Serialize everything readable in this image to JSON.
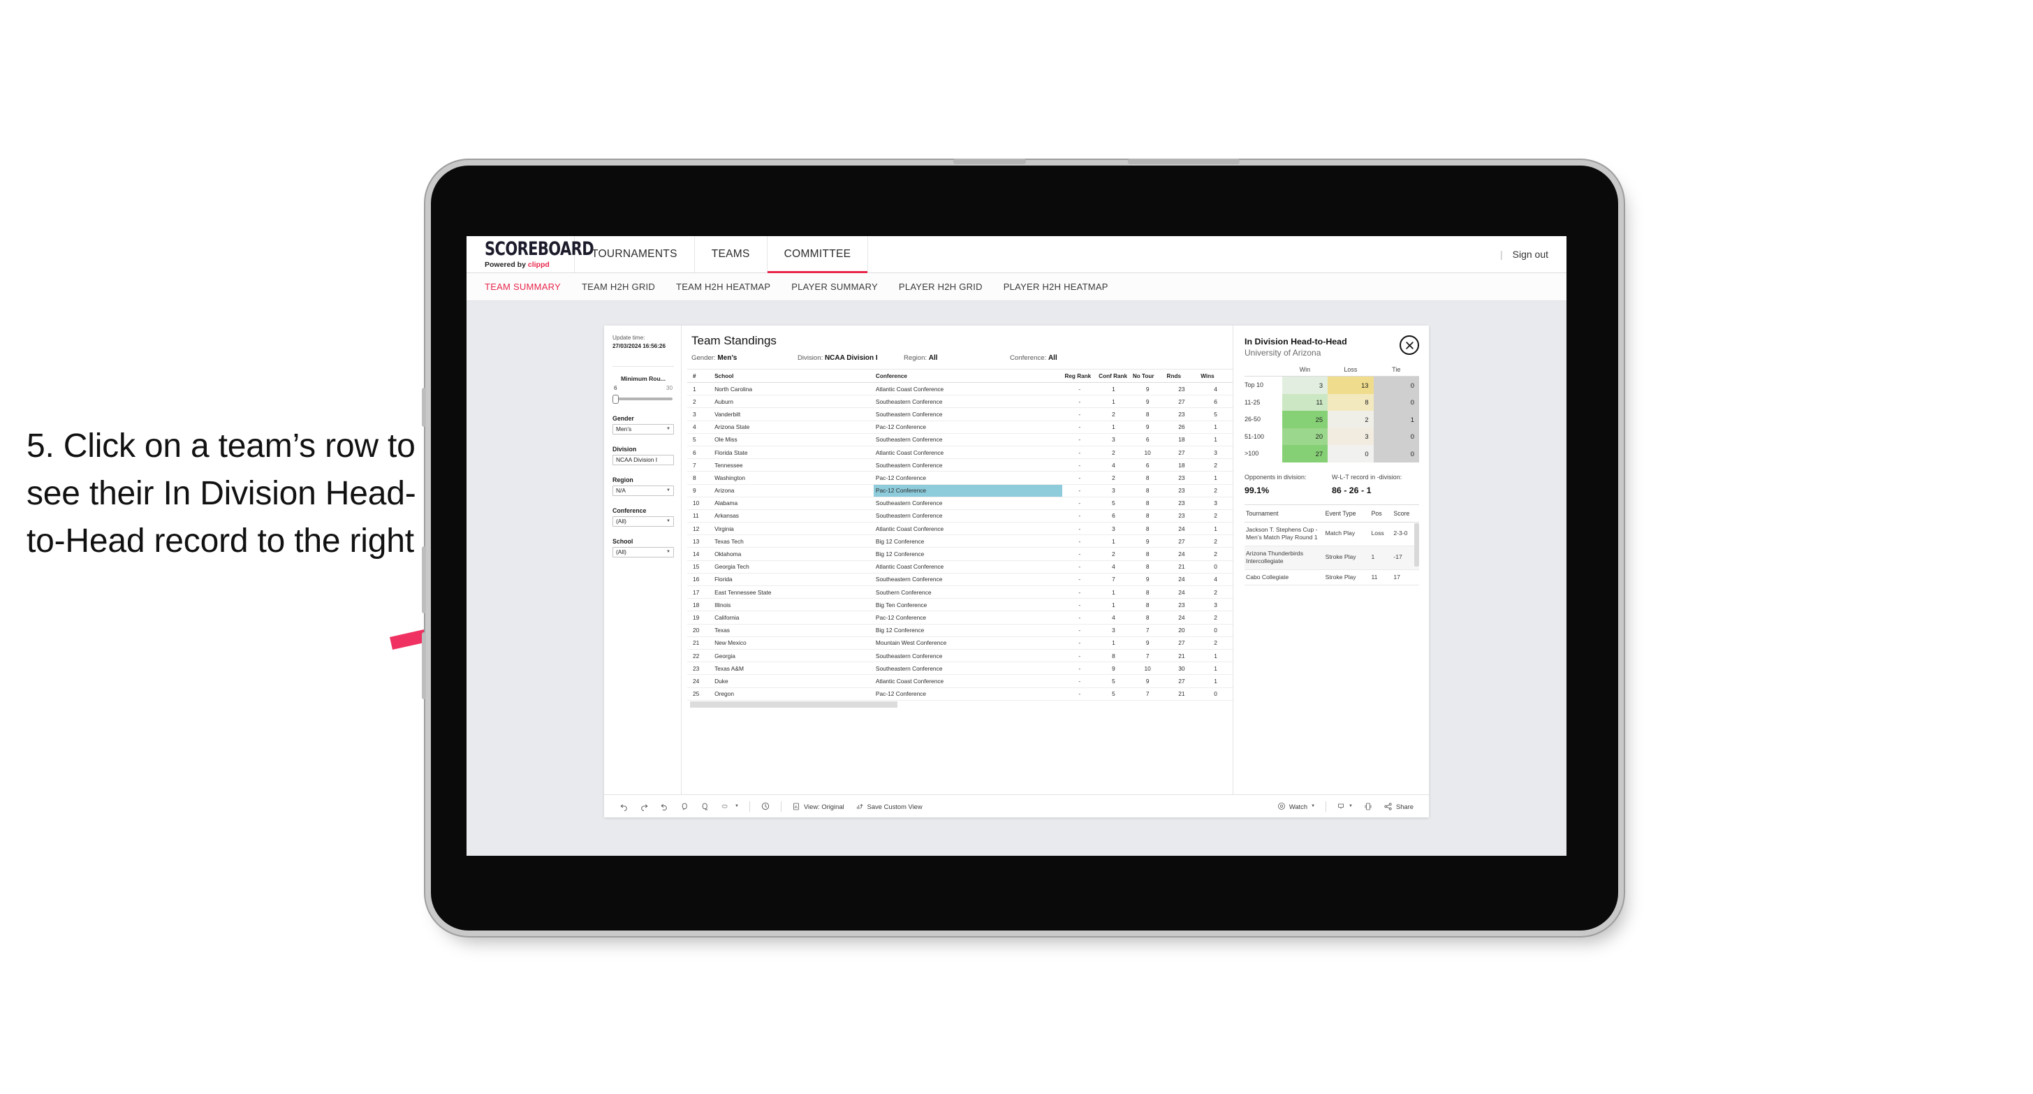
{
  "annotation": {
    "text": "5. Click on a team’s row to see their In Division Head-to-Head record to the right",
    "accent_color": "#e8274b"
  },
  "topnav": {
    "logo_main": "SCOREBOARD",
    "logo_powered": "Powered by",
    "logo_brand": "clippd",
    "items": [
      {
        "label": "TOURNAMENTS",
        "active": false
      },
      {
        "label": "TEAMS",
        "active": false
      },
      {
        "label": "COMMITTEE",
        "active": true
      }
    ],
    "separator": "|",
    "signout": "Sign out"
  },
  "subnav": {
    "items": [
      {
        "label": "TEAM SUMMARY",
        "active": true
      },
      {
        "label": "TEAM H2H GRID",
        "active": false
      },
      {
        "label": "TEAM H2H HEATMAP",
        "active": false
      },
      {
        "label": "PLAYER SUMMARY",
        "active": false
      },
      {
        "label": "PLAYER H2H GRID",
        "active": false
      },
      {
        "label": "PLAYER H2H HEATMAP",
        "active": false
      }
    ]
  },
  "filters": {
    "update_label": "Update time:",
    "update_time": "27/03/2024 16:56:26",
    "slider": {
      "title": "Minimum Rou...",
      "min": "6",
      "max": "30"
    },
    "groups": [
      {
        "label": "Gender",
        "value": "Men’s"
      },
      {
        "label": "Division",
        "value": "NCAA Division I"
      },
      {
        "label": "Region",
        "value": "N/A"
      },
      {
        "label": "Conference",
        "value": "(All)"
      },
      {
        "label": "School",
        "value": "(All)"
      }
    ]
  },
  "standings": {
    "title": "Team Standings",
    "meta": [
      {
        "key": "Gender:",
        "value": "Men’s"
      },
      {
        "key": "Division:",
        "value": "NCAA Division I"
      },
      {
        "key": "Region:",
        "value": "All"
      },
      {
        "key": "Conference:",
        "value": "All"
      }
    ],
    "columns": [
      "#",
      "School",
      "Conference",
      "Reg Rank",
      "Conf Rank",
      "No Tour",
      "Rnds",
      "Wins"
    ],
    "rows": [
      {
        "rank": "1",
        "school": "North Carolina",
        "conference": "Atlantic Coast Conference",
        "reg": "-",
        "conf": "1",
        "tour": "9",
        "rnds": "23",
        "wins": "4",
        "highlight": false
      },
      {
        "rank": "2",
        "school": "Auburn",
        "conference": "Southeastern Conference",
        "reg": "-",
        "conf": "1",
        "tour": "9",
        "rnds": "27",
        "wins": "6",
        "highlight": false
      },
      {
        "rank": "3",
        "school": "Vanderbilt",
        "conference": "Southeastern Conference",
        "reg": "-",
        "conf": "2",
        "tour": "8",
        "rnds": "23",
        "wins": "5",
        "highlight": false
      },
      {
        "rank": "4",
        "school": "Arizona State",
        "conference": "Pac-12 Conference",
        "reg": "-",
        "conf": "1",
        "tour": "9",
        "rnds": "26",
        "wins": "1",
        "highlight": false
      },
      {
        "rank": "5",
        "school": "Ole Miss",
        "conference": "Southeastern Conference",
        "reg": "-",
        "conf": "3",
        "tour": "6",
        "rnds": "18",
        "wins": "1",
        "highlight": false
      },
      {
        "rank": "6",
        "school": "Florida State",
        "conference": "Atlantic Coast Conference",
        "reg": "-",
        "conf": "2",
        "tour": "10",
        "rnds": "27",
        "wins": "3",
        "highlight": false
      },
      {
        "rank": "7",
        "school": "Tennessee",
        "conference": "Southeastern Conference",
        "reg": "-",
        "conf": "4",
        "tour": "6",
        "rnds": "18",
        "wins": "2",
        "highlight": false
      },
      {
        "rank": "8",
        "school": "Washington",
        "conference": "Pac-12 Conference",
        "reg": "-",
        "conf": "2",
        "tour": "8",
        "rnds": "23",
        "wins": "1",
        "highlight": false
      },
      {
        "rank": "9",
        "school": "Arizona",
        "conference": "Pac-12 Conference",
        "reg": "-",
        "conf": "3",
        "tour": "8",
        "rnds": "23",
        "wins": "2",
        "highlight": true
      },
      {
        "rank": "10",
        "school": "Alabama",
        "conference": "Southeastern Conference",
        "reg": "-",
        "conf": "5",
        "tour": "8",
        "rnds": "23",
        "wins": "3",
        "highlight": false
      },
      {
        "rank": "11",
        "school": "Arkansas",
        "conference": "Southeastern Conference",
        "reg": "-",
        "conf": "6",
        "tour": "8",
        "rnds": "23",
        "wins": "2",
        "highlight": false
      },
      {
        "rank": "12",
        "school": "Virginia",
        "conference": "Atlantic Coast Conference",
        "reg": "-",
        "conf": "3",
        "tour": "8",
        "rnds": "24",
        "wins": "1",
        "highlight": false
      },
      {
        "rank": "13",
        "school": "Texas Tech",
        "conference": "Big 12 Conference",
        "reg": "-",
        "conf": "1",
        "tour": "9",
        "rnds": "27",
        "wins": "2",
        "highlight": false
      },
      {
        "rank": "14",
        "school": "Oklahoma",
        "conference": "Big 12 Conference",
        "reg": "-",
        "conf": "2",
        "tour": "8",
        "rnds": "24",
        "wins": "2",
        "highlight": false
      },
      {
        "rank": "15",
        "school": "Georgia Tech",
        "conference": "Atlantic Coast Conference",
        "reg": "-",
        "conf": "4",
        "tour": "8",
        "rnds": "21",
        "wins": "0",
        "highlight": false
      },
      {
        "rank": "16",
        "school": "Florida",
        "conference": "Southeastern Conference",
        "reg": "-",
        "conf": "7",
        "tour": "9",
        "rnds": "24",
        "wins": "4",
        "highlight": false
      },
      {
        "rank": "17",
        "school": "East Tennessee State",
        "conference": "Southern Conference",
        "reg": "-",
        "conf": "1",
        "tour": "8",
        "rnds": "24",
        "wins": "2",
        "highlight": false
      },
      {
        "rank": "18",
        "school": "Illinois",
        "conference": "Big Ten Conference",
        "reg": "-",
        "conf": "1",
        "tour": "8",
        "rnds": "23",
        "wins": "3",
        "highlight": false
      },
      {
        "rank": "19",
        "school": "California",
        "conference": "Pac-12 Conference",
        "reg": "-",
        "conf": "4",
        "tour": "8",
        "rnds": "24",
        "wins": "2",
        "highlight": false
      },
      {
        "rank": "20",
        "school": "Texas",
        "conference": "Big 12 Conference",
        "reg": "-",
        "conf": "3",
        "tour": "7",
        "rnds": "20",
        "wins": "0",
        "highlight": false
      },
      {
        "rank": "21",
        "school": "New Mexico",
        "conference": "Mountain West Conference",
        "reg": "-",
        "conf": "1",
        "tour": "9",
        "rnds": "27",
        "wins": "2",
        "highlight": false
      },
      {
        "rank": "22",
        "school": "Georgia",
        "conference": "Southeastern Conference",
        "reg": "-",
        "conf": "8",
        "tour": "7",
        "rnds": "21",
        "wins": "1",
        "highlight": false
      },
      {
        "rank": "23",
        "school": "Texas A&M",
        "conference": "Southeastern Conference",
        "reg": "-",
        "conf": "9",
        "tour": "10",
        "rnds": "30",
        "wins": "1",
        "highlight": false
      },
      {
        "rank": "24",
        "school": "Duke",
        "conference": "Atlantic Coast Conference",
        "reg": "-",
        "conf": "5",
        "tour": "9",
        "rnds": "27",
        "wins": "1",
        "highlight": false
      },
      {
        "rank": "25",
        "school": "Oregon",
        "conference": "Pac-12 Conference",
        "reg": "-",
        "conf": "5",
        "tour": "7",
        "rnds": "21",
        "wins": "0",
        "highlight": false
      }
    ]
  },
  "h2h": {
    "title": "In Division Head-to-Head",
    "subtitle": "University of Arizona",
    "close_icon": "close-icon",
    "opponents_label": "Opponents in division:",
    "opponents_value": "99.1%",
    "record_label": "W-L-T record in -division:",
    "record_value": "86 - 26 - 1",
    "tournament_columns": [
      "Tournament",
      "Event Type",
      "Pos",
      "Score"
    ],
    "tournaments": [
      {
        "name": "Jackson T. Stephens Cup - Men’s Match Play Round 1",
        "type": "Match Play",
        "pos": "Loss",
        "score": "2-3-0"
      },
      {
        "name": "Arizona Thunderbirds Intercollegiate",
        "type": "Stroke Play",
        "pos": "1",
        "score": "-17"
      },
      {
        "name": "Cabo Collegiate",
        "type": "Stroke Play",
        "pos": "11",
        "score": "17"
      }
    ]
  },
  "chart_data": {
    "type": "heatmap",
    "title": "In Division Head-to-Head",
    "subtitle": "University of Arizona",
    "columns": [
      "Win",
      "Loss",
      "Tie"
    ],
    "categories": [
      "Top 10",
      "11-25",
      "26-50",
      "51-100",
      ">100"
    ],
    "series": [
      {
        "name": "Win",
        "values": [
          3,
          11,
          25,
          20,
          27
        ]
      },
      {
        "name": "Loss",
        "values": [
          13,
          8,
          2,
          3,
          0
        ]
      },
      {
        "name": "Tie",
        "values": [
          0,
          0,
          1,
          0,
          0
        ]
      }
    ],
    "cell_colors": {
      "win": [
        "#e2efe0",
        "#cce7c3",
        "#86d076",
        "#9bd78c",
        "#85cf75"
      ],
      "loss": [
        "#efdc8c",
        "#f3e9bf",
        "#f0efe7",
        "#f2ece0",
        "#f1f1ef"
      ],
      "tie": [
        "#cfcfcf",
        "#cfcfcf",
        "#cfcfcf",
        "#cfcfcf",
        "#cfcfcf"
      ]
    },
    "legend_position": "top",
    "grid": false
  },
  "toolbar": {
    "items": [
      {
        "name": "undo-icon",
        "label": ""
      },
      {
        "name": "redo-icon",
        "label": ""
      },
      {
        "name": "revert-icon",
        "label": ""
      },
      {
        "name": "refresh-icon",
        "label": ""
      },
      {
        "name": "pause-icon",
        "label": ""
      },
      {
        "name": "highlight-icon",
        "label": ""
      },
      {
        "name": "pause-auto-updates-icon",
        "label": ""
      }
    ],
    "view_label": "View: Original",
    "save_label": "Save Custom View",
    "watch_label": "Watch",
    "share_label": "Share"
  }
}
